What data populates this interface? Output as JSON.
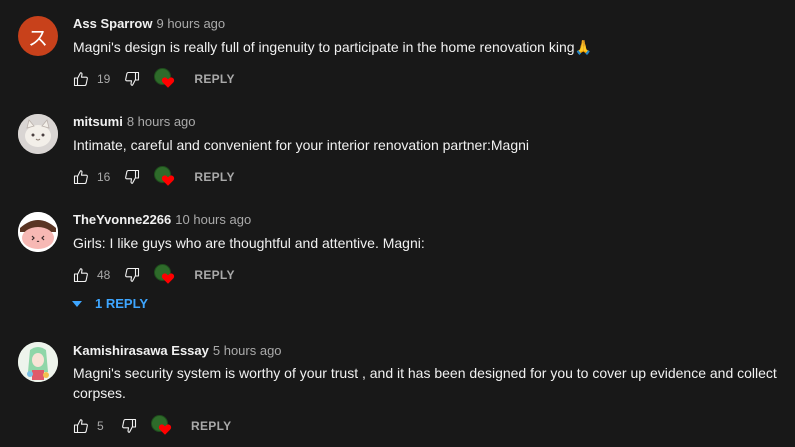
{
  "comments": [
    {
      "author": "Ass Sparrow",
      "time": "9 hours ago",
      "avatar_letter": "ス",
      "text": "Magni's design is really full of ingenuity to participate in the home renovation king🙏",
      "likes": "19",
      "reply_label": "REPLY"
    },
    {
      "author": "mitsumi",
      "time": "8 hours ago",
      "text": "Intimate, careful and convenient for your interior renovation partner:Magni",
      "likes": "16",
      "reply_label": "REPLY"
    },
    {
      "author": "TheYvonne2266",
      "time": "10 hours ago",
      "text": "Girls: I like guys who are thoughtful and attentive. Magni:",
      "likes": "48",
      "reply_label": "REPLY",
      "replies_toggle": "1 REPLY"
    },
    {
      "author": "Kamishirasawa Essay",
      "time": "5 hours ago",
      "text": "Magni's security system is worthy of your trust , and it has been designed for you to cover up evidence and collect corpses.",
      "likes": "5",
      "reply_label": "REPLY"
    }
  ],
  "colors": {
    "background": "#181818",
    "link_blue": "#3ea6ff",
    "heart_red": "#ff0000"
  }
}
